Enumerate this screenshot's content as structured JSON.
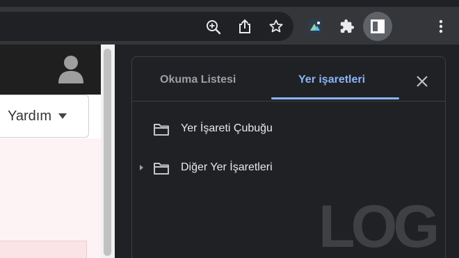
{
  "toolbar": {
    "icons": {
      "zoom": "zoom-in-icon",
      "share": "share-icon",
      "bookmark": "bookmark-star-icon",
      "extension_app": "extension-app-icon",
      "extensions": "puzzle-extensions-icon",
      "side_panel": "side-panel-icon",
      "menu": "kebab-menu-icon"
    }
  },
  "page": {
    "help_label": "Yardım"
  },
  "side_panel": {
    "tabs": [
      {
        "label": "Okuma Listesi",
        "selected": false
      },
      {
        "label": "Yer işaretleri",
        "selected": true
      }
    ],
    "bookmarks": [
      {
        "label": "Yer İşareti Çubuğu",
        "expandable": false
      },
      {
        "label": "Diğer Yer İşaretleri",
        "expandable": true
      }
    ]
  },
  "watermark": {
    "text": "LOG"
  },
  "colors": {
    "accent": "#8ab4f8",
    "panel_bg": "#202124",
    "toolbar_bg": "#35363a",
    "text": "#e8eaed",
    "muted": "#9aa0a6"
  }
}
